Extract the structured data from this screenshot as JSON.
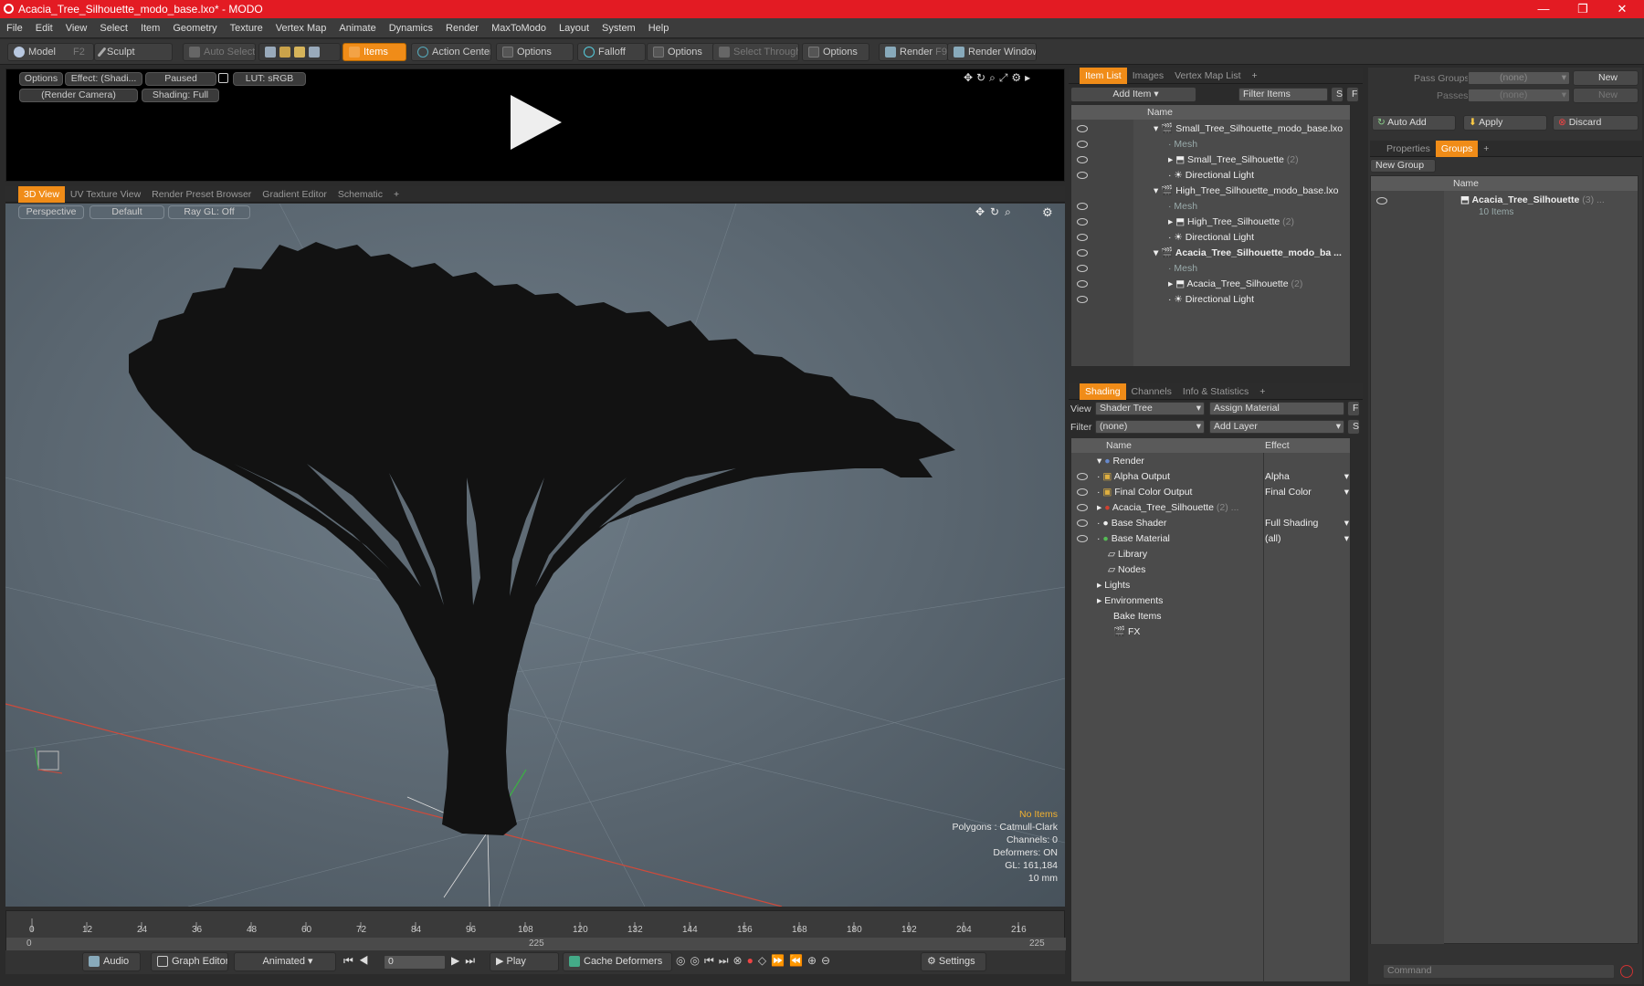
{
  "window": {
    "title": "Acacia_Tree_Silhouette_modo_base.lxo* - MODO",
    "minimize": "—",
    "maximize": "❐",
    "close": "✕"
  },
  "menu": [
    "File",
    "Edit",
    "View",
    "Select",
    "Item",
    "Geometry",
    "Texture",
    "Vertex Map",
    "Animate",
    "Dynamics",
    "Render",
    "MaxToModo",
    "Layout",
    "System",
    "Help"
  ],
  "toolbar": {
    "model": "Model",
    "model_key": "F2",
    "sculpt": "Sculpt",
    "auto_select": "Auto Select",
    "items": "Items",
    "action_center": "Action Center",
    "options1": "Options",
    "falloff": "Falloff",
    "options2": "Options",
    "select_through": "Select Through",
    "options3": "Options",
    "render": "Render",
    "render_key": "F9",
    "render_window": "Render Window"
  },
  "preview": {
    "options": "Options",
    "effect": "Effect: (Shadi...",
    "paused": "Paused",
    "lut": "LUT: sRGB",
    "camera": "(Render Camera)",
    "shading": "Shading: Full"
  },
  "viewport_tabs": [
    "3D View",
    "UV Texture View",
    "Render Preset Browser",
    "Gradient Editor",
    "Schematic",
    "+"
  ],
  "viewport": {
    "perspective": "Perspective",
    "default": "Default",
    "raygl": "Ray GL: Off"
  },
  "viewport_info": {
    "no_items": "No Items",
    "polygons": "Polygons : Catmull-Clark",
    "channels": "Channels: 0",
    "deformers": "Deformers: ON",
    "gl": "GL: 161,184",
    "scale": "10 mm"
  },
  "timeline": {
    "ticks": [
      "0",
      "12",
      "24",
      "36",
      "48",
      "60",
      "72",
      "84",
      "96",
      "108",
      "120",
      "132",
      "144",
      "156",
      "168",
      "180",
      "192",
      "204",
      "216"
    ],
    "start": "0",
    "mid": "225",
    "end": "225"
  },
  "bottombar": {
    "audio": "Audio",
    "graph_editor": "Graph Editor",
    "animated": "Animated",
    "frame": "0",
    "play": "Play",
    "cache": "Cache Deformers",
    "settings": "Settings"
  },
  "itemlist": {
    "tabs": [
      "Item List",
      "Images",
      "Vertex Map List",
      "+"
    ],
    "add_item": "Add Item",
    "filter_items": "Filter Items",
    "s": "S",
    "f": "F",
    "col_name": "Name",
    "rows": [
      {
        "label": "Small_Tree_Silhouette_modo_base.lxo",
        "count": ""
      },
      {
        "label": "Mesh",
        "count": ""
      },
      {
        "label": "Small_Tree_Silhouette",
        "count": "(2)"
      },
      {
        "label": "Directional Light",
        "count": ""
      },
      {
        "label": "High_Tree_Silhouette_modo_base.lxo",
        "count": ""
      },
      {
        "label": "Mesh",
        "count": ""
      },
      {
        "label": "High_Tree_Silhouette",
        "count": "(2)"
      },
      {
        "label": "Directional Light",
        "count": ""
      },
      {
        "label": "Acacia_Tree_Silhouette_modo_ba ...",
        "count": ""
      },
      {
        "label": "Mesh",
        "count": ""
      },
      {
        "label": "Acacia_Tree_Silhouette",
        "count": "(2)"
      },
      {
        "label": "Directional Light",
        "count": ""
      }
    ]
  },
  "shading": {
    "tabs": [
      "Shading",
      "Channels",
      "Info & Statistics",
      "+"
    ],
    "view_label": "View",
    "view_value": "Shader Tree",
    "assign_material": "Assign Material",
    "f": "F",
    "filter_label": "Filter",
    "filter_value": "(none)",
    "add_layer": "Add Layer",
    "s": "S",
    "col_name": "Name",
    "col_effect": "Effect",
    "rows": [
      {
        "label": "Render",
        "effect": ""
      },
      {
        "label": "Alpha Output",
        "effect": "Alpha"
      },
      {
        "label": "Final Color Output",
        "effect": "Final Color"
      },
      {
        "label": "Acacia_Tree_Silhouette",
        "count": "(2) ...",
        "effect": ""
      },
      {
        "label": "Base Shader",
        "effect": "Full Shading"
      },
      {
        "label": "Base Material",
        "effect": "(all)"
      },
      {
        "label": "Library",
        "effect": ""
      },
      {
        "label": "Nodes",
        "effect": ""
      },
      {
        "label": "Lights",
        "effect": ""
      },
      {
        "label": "Environments",
        "effect": ""
      },
      {
        "label": "Bake Items",
        "effect": ""
      },
      {
        "label": "FX",
        "effect": ""
      }
    ]
  },
  "groups": {
    "pass_groups_label": "Pass Groups",
    "pass_groups_value": "(none)",
    "new1": "New",
    "passes_label": "Passes",
    "passes_value": "(none)",
    "new2": "New",
    "auto_add": "Auto Add",
    "apply": "Apply",
    "discard": "Discard",
    "tabs": [
      "Properties",
      "Groups",
      "+"
    ],
    "new_group": "New Group",
    "col_name": "Name",
    "group_name": "Acacia_Tree_Silhouette",
    "group_count": "(3) ...",
    "group_items": "10 Items"
  },
  "command": {
    "placeholder": "Command"
  }
}
